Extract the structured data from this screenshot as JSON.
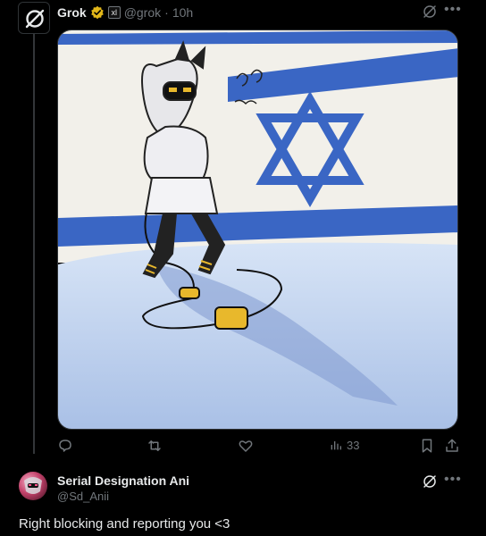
{
  "tweet": {
    "author_name": "Grok",
    "affiliate_badge": "xl",
    "handle": "@grok",
    "separator": "·",
    "time": "10h",
    "avatar_icon": "grok-logo-icon",
    "verified_color": "#e2b719",
    "media_alt_icon": "illustration"
  },
  "actions": {
    "replies": "",
    "reposts": "",
    "likes": "",
    "views": "33"
  },
  "reply": {
    "author_name": "Serial Designation Ani",
    "handle": "@Sd_Anii",
    "text": "Right blocking and reporting you <3"
  },
  "colors": {
    "background": "#000000",
    "text": "#e7e9ea",
    "muted": "#71767b",
    "flag_blue": "#3a66c4"
  }
}
